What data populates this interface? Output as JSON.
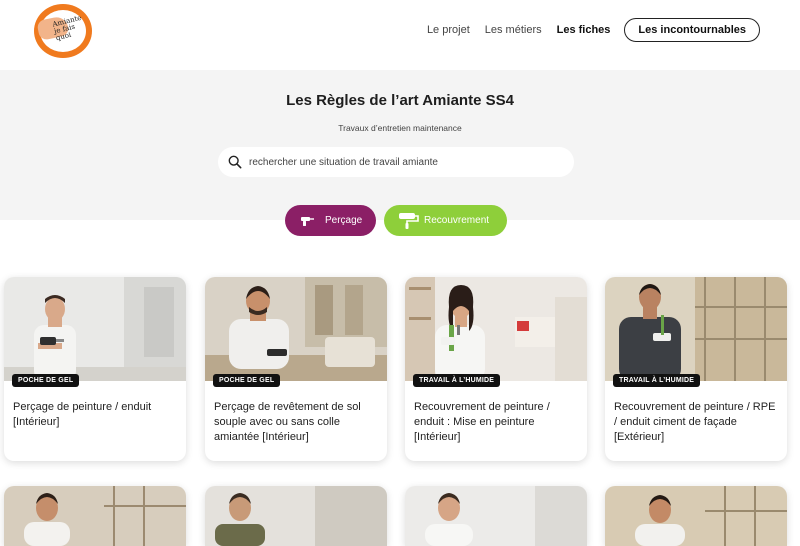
{
  "header": {
    "logo_alt": "Amiante je fais quoi",
    "nav": [
      {
        "label": "Le projet",
        "active": false
      },
      {
        "label": "Les métiers",
        "active": false
      },
      {
        "label": "Les fiches",
        "active": true
      }
    ],
    "cta_label": "Les incontournables"
  },
  "hero": {
    "title": "Les Règles de l’art Amiante SS4",
    "subtitle": "Travaux d’entretien maintenance",
    "search_placeholder": "rechercher une situation de travail amiante"
  },
  "filters": [
    {
      "label": "Perçage",
      "color": "#8b1f66",
      "icon": "drill-icon"
    },
    {
      "label": "Recouvrement",
      "color": "#8ecf3a",
      "icon": "paint-roller-icon"
    }
  ],
  "cards": [
    {
      "badge": "POCHE DE GEL",
      "title": "Perçage de peinture / enduit [Intérieur]"
    },
    {
      "badge": "POCHE DE GEL",
      "title": "Perçage de revêtement de sol souple avec ou sans colle amiantée [Intérieur]"
    },
    {
      "badge": "TRAVAIL À L’HUMIDE",
      "title": "Recouvrement de peinture / enduit : Mise en peinture [Intérieur]"
    },
    {
      "badge": "TRAVAIL À L’HUMIDE",
      "title": "Recouvrement de peinture / RPE / enduit ciment de façade [Extérieur]"
    }
  ]
}
